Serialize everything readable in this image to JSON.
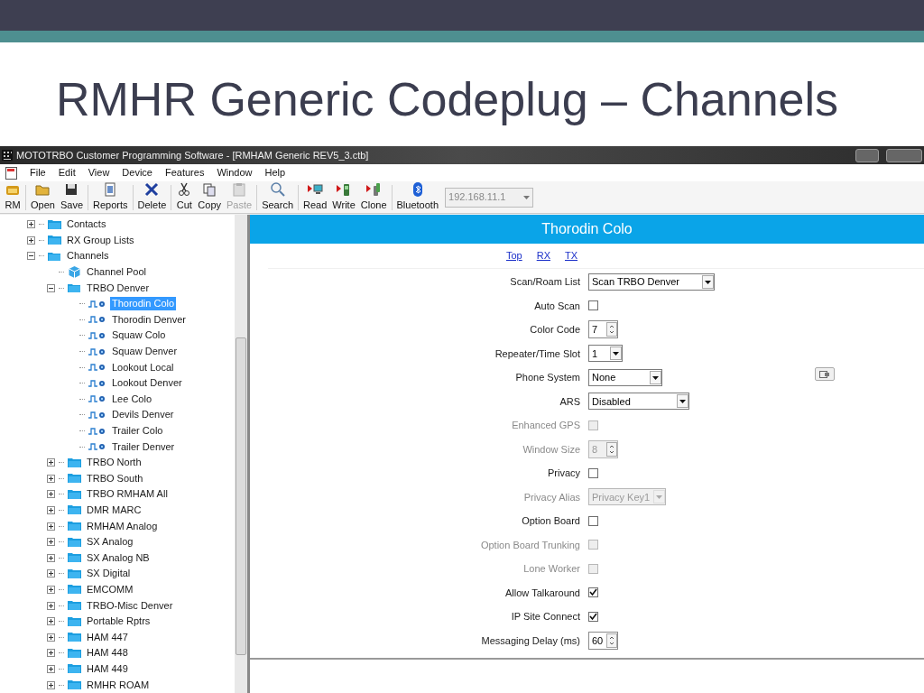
{
  "slide": {
    "title": "RMHR Generic Codeplug – Channels"
  },
  "window": {
    "title": "MOTOTRBO Customer Programming Software - [RMHAM Generic REV5_3.ctb]"
  },
  "menu": [
    "File",
    "Edit",
    "View",
    "Device",
    "Features",
    "Window",
    "Help"
  ],
  "toolbar": [
    {
      "label": "RM",
      "kind": "rm",
      "disabled": false
    },
    {
      "label": "Open",
      "kind": "open",
      "disabled": false
    },
    {
      "label": "Save",
      "kind": "save",
      "disabled": false
    },
    {
      "label": "Reports",
      "kind": "reports",
      "disabled": false
    },
    {
      "label": "Delete",
      "kind": "delete",
      "disabled": false
    },
    {
      "label": "Cut",
      "kind": "cut",
      "disabled": false
    },
    {
      "label": "Copy",
      "kind": "copy",
      "disabled": false
    },
    {
      "label": "Paste",
      "kind": "paste",
      "disabled": true
    },
    {
      "label": "Search",
      "kind": "search",
      "disabled": false
    },
    {
      "label": "Read",
      "kind": "read",
      "disabled": false
    },
    {
      "label": "Write",
      "kind": "write",
      "disabled": false
    },
    {
      "label": "Clone",
      "kind": "clone",
      "disabled": false
    },
    {
      "label": "Bluetooth",
      "kind": "bluetooth",
      "disabled": false
    }
  ],
  "address": {
    "value": "192.168.11.1",
    "disabled": true
  },
  "tree": [
    {
      "label": "Contacts",
      "kind": "folder",
      "expanded": false,
      "selected": false
    },
    {
      "label": "RX Group Lists",
      "kind": "folder",
      "expanded": false,
      "selected": false
    },
    {
      "label": "Channels",
      "kind": "folder",
      "expanded": true,
      "selected": false,
      "children": [
        {
          "label": "Channel Pool",
          "kind": "pool",
          "selected": false
        },
        {
          "label": "TRBO Denver",
          "kind": "folder",
          "expanded": true,
          "selected": false,
          "children": [
            {
              "label": "Thorodin Colo",
              "kind": "channel",
              "selected": true
            },
            {
              "label": "Thorodin Denver",
              "kind": "channel",
              "selected": false
            },
            {
              "label": "Squaw Colo",
              "kind": "channel",
              "selected": false
            },
            {
              "label": "Squaw Denver",
              "kind": "channel",
              "selected": false
            },
            {
              "label": "Lookout Local",
              "kind": "channel",
              "selected": false
            },
            {
              "label": "Lookout Denver",
              "kind": "channel",
              "selected": false
            },
            {
              "label": "Lee Colo",
              "kind": "channel",
              "selected": false
            },
            {
              "label": "Devils Denver",
              "kind": "channel",
              "selected": false
            },
            {
              "label": "Trailer  Colo",
              "kind": "channel",
              "selected": false
            },
            {
              "label": "Trailer Denver",
              "kind": "channel",
              "selected": false
            }
          ]
        },
        {
          "label": "TRBO North",
          "kind": "folder",
          "expanded": false,
          "selected": false
        },
        {
          "label": "TRBO South",
          "kind": "folder",
          "expanded": false,
          "selected": false
        },
        {
          "label": "TRBO RMHAM All",
          "kind": "folder",
          "expanded": false,
          "selected": false
        },
        {
          "label": "DMR MARC",
          "kind": "folder",
          "expanded": false,
          "selected": false
        },
        {
          "label": "RMHAM Analog",
          "kind": "folder",
          "expanded": false,
          "selected": false
        },
        {
          "label": "SX Analog",
          "kind": "folder",
          "expanded": false,
          "selected": false
        },
        {
          "label": "SX Analog NB",
          "kind": "folder",
          "expanded": false,
          "selected": false
        },
        {
          "label": "SX Digital",
          "kind": "folder",
          "expanded": false,
          "selected": false
        },
        {
          "label": "EMCOMM",
          "kind": "folder",
          "expanded": false,
          "selected": false
        },
        {
          "label": "TRBO-Misc Denver",
          "kind": "folder",
          "expanded": false,
          "selected": false
        },
        {
          "label": "Portable Rptrs",
          "kind": "folder",
          "expanded": false,
          "selected": false
        },
        {
          "label": "HAM 447",
          "kind": "folder",
          "expanded": false,
          "selected": false
        },
        {
          "label": "HAM 448",
          "kind": "folder",
          "expanded": false,
          "selected": false
        },
        {
          "label": "HAM 449",
          "kind": "folder",
          "expanded": false,
          "selected": false
        },
        {
          "label": "RMHR ROAM",
          "kind": "folder",
          "expanded": false,
          "selected": false
        }
      ]
    }
  ],
  "panel": {
    "title": "Thorodin Colo",
    "links": [
      "Top",
      "RX",
      "TX"
    ],
    "fields": [
      {
        "label": "Scan/Roam List",
        "kind": "dropdown",
        "value": "Scan TRBO Denver",
        "disabled": false
      },
      {
        "label": "Auto Scan",
        "kind": "checkbox",
        "checked": false,
        "disabled": false
      },
      {
        "label": "Color Code",
        "kind": "spinner",
        "value": "7",
        "disabled": false
      },
      {
        "label": "Repeater/Time Slot",
        "kind": "dropdown",
        "value": "1",
        "disabled": false
      },
      {
        "label": "Phone System",
        "kind": "dropdown",
        "value": "None",
        "disabled": false,
        "side_button": true
      },
      {
        "label": "ARS",
        "kind": "dropdown",
        "value": "Disabled",
        "disabled": false
      },
      {
        "label": "Enhanced GPS",
        "kind": "checkbox",
        "checked": false,
        "disabled": true
      },
      {
        "label": "Window Size",
        "kind": "spinner",
        "value": "8",
        "disabled": true
      },
      {
        "label": "Privacy",
        "kind": "checkbox",
        "checked": false,
        "disabled": false
      },
      {
        "label": "Privacy Alias",
        "kind": "dropdown",
        "value": "Privacy Key1",
        "disabled": true
      },
      {
        "label": "Option Board",
        "kind": "checkbox",
        "checked": false,
        "disabled": false
      },
      {
        "label": "Option Board Trunking",
        "kind": "checkbox",
        "checked": false,
        "disabled": true
      },
      {
        "label": "Lone Worker",
        "kind": "checkbox",
        "checked": false,
        "disabled": true
      },
      {
        "label": "Allow Talkaround",
        "kind": "checkbox",
        "checked": true,
        "disabled": false
      },
      {
        "label": "IP Site Connect",
        "kind": "checkbox",
        "checked": true,
        "disabled": false
      },
      {
        "label": "Messaging Delay (ms)",
        "kind": "spinner",
        "value": "60",
        "disabled": false
      }
    ]
  }
}
